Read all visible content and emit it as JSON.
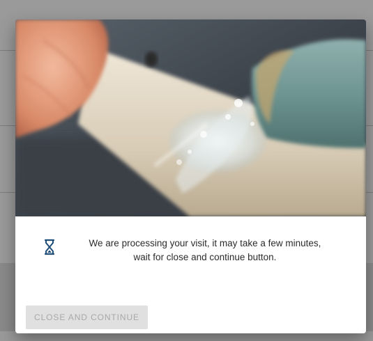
{
  "modal": {
    "hero_image_icon": "water-splash-photo",
    "status_icon": "hourglass-icon",
    "message_line1": "We are processing your visit, it may take a few minutes,",
    "message_line2": "wait for close and continue button.",
    "close_button_label": "CLOSE AND CONTINUE",
    "close_button_disabled": true
  },
  "colors": {
    "overlay": "#8f8f8f",
    "modal_bg": "#ffffff",
    "icon": "#1f4e79",
    "button_bg_disabled": "#e0e0e0",
    "button_text_disabled": "#a8a8a8",
    "text": "#2b2b2b"
  }
}
